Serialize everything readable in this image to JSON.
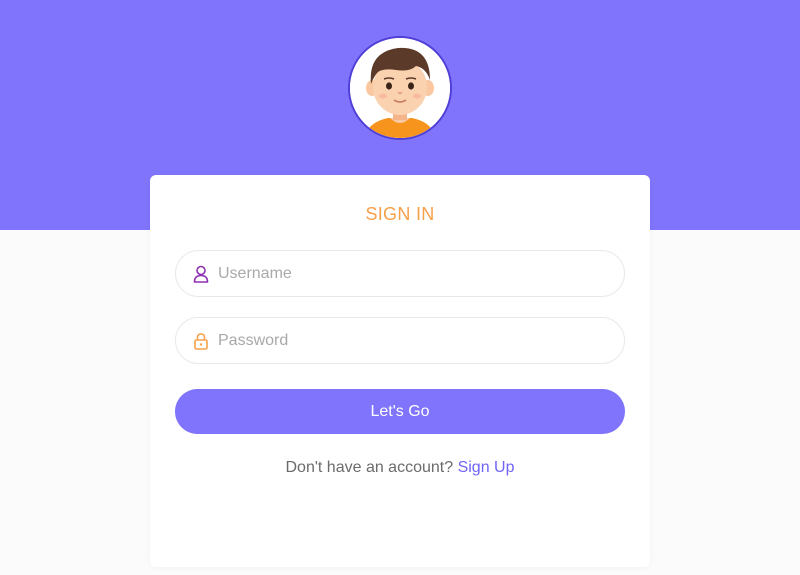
{
  "avatar": {
    "icon": "boy-avatar-icon"
  },
  "form": {
    "title": "SIGN IN",
    "username": {
      "placeholder": "Username",
      "value": "",
      "icon": "user-icon"
    },
    "password": {
      "placeholder": "Password",
      "value": "",
      "icon": "lock-icon"
    },
    "submit_label": "Let's Go",
    "signup_prompt": "Don't have an account?",
    "signup_link": "Sign Up"
  },
  "colors": {
    "banner": "#7f74fb",
    "title": "#f7a04a",
    "button": "#7f74fb",
    "link": "#7064f5",
    "page_background": "#fbfbfb"
  }
}
